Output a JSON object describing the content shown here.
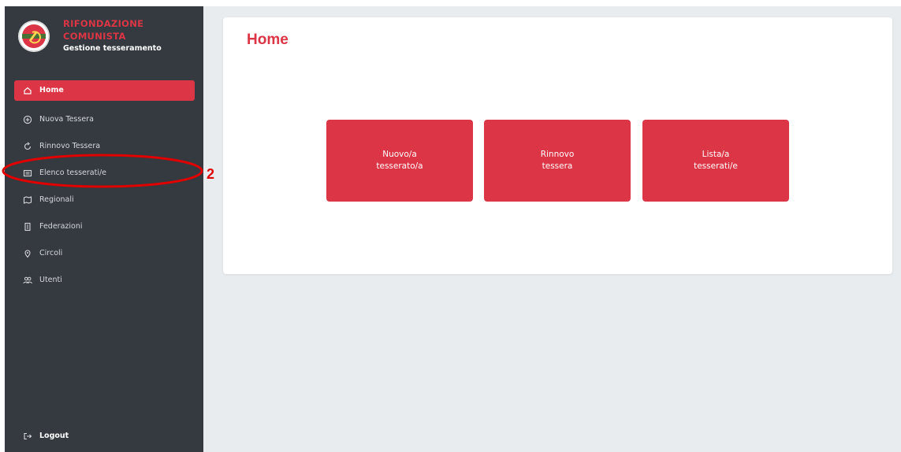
{
  "brand": {
    "line1": "RIFONDAZIONE",
    "line2": "COMUNISTA",
    "line3": "Gestione tesseramento",
    "logo_icon": "party-logo-icon"
  },
  "sidebar": {
    "items": [
      {
        "label": "Home",
        "icon": "home-icon",
        "active": true
      },
      {
        "label": "Nuova Tessera",
        "icon": "plus-circle-icon",
        "active": false
      },
      {
        "label": "Rinnovo Tessera",
        "icon": "refresh-icon",
        "active": false
      },
      {
        "label": "Elenco tesserati/e",
        "icon": "list-card-icon",
        "active": false
      },
      {
        "label": "Regionali",
        "icon": "map-icon",
        "active": false
      },
      {
        "label": "Federazioni",
        "icon": "building-icon",
        "active": false
      },
      {
        "label": "Circoli",
        "icon": "circle-location-icon",
        "active": false
      },
      {
        "label": "Utenti",
        "icon": "users-icon",
        "active": false
      }
    ],
    "logout": {
      "label": "Logout",
      "icon": "logout-icon"
    }
  },
  "annotation": {
    "number": "2"
  },
  "main": {
    "title": "Home",
    "buttons": [
      {
        "line1": "Nuovo/a",
        "line2": "tesserato/a"
      },
      {
        "line1": "Rinnovo",
        "line2": "tessera"
      },
      {
        "line1": "Lista/a",
        "line2": "tesserati/e"
      }
    ]
  },
  "colors": {
    "accent": "#dc3545",
    "sidebar_bg": "#343a40",
    "page_bg": "#e9ecef",
    "annotation": "#e00000"
  }
}
